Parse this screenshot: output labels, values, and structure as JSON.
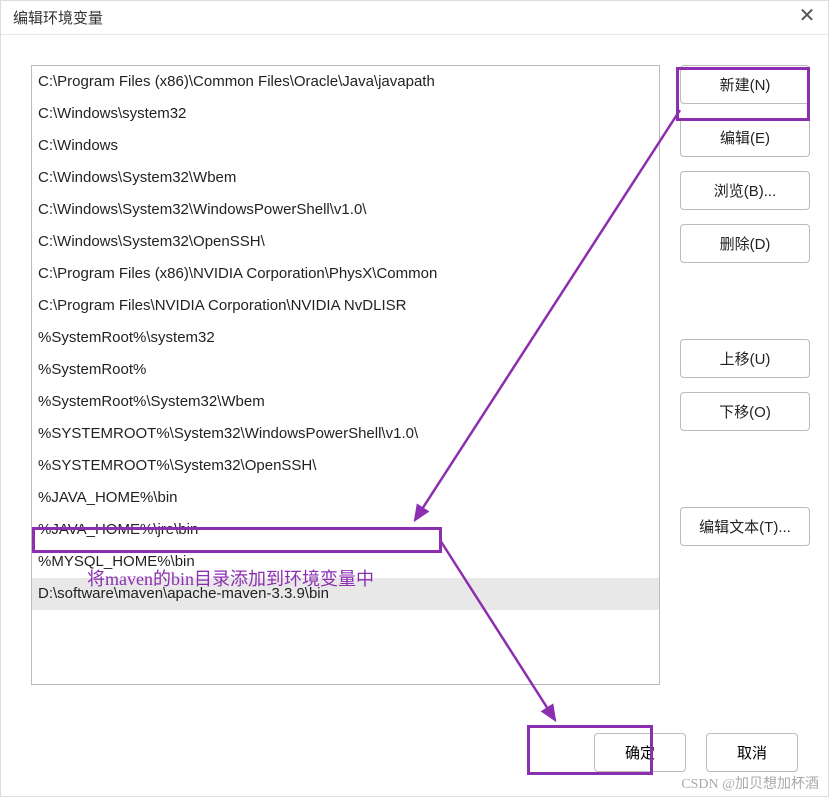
{
  "window": {
    "title": "编辑环境变量"
  },
  "list": {
    "items": [
      "C:\\Program Files (x86)\\Common Files\\Oracle\\Java\\javapath",
      "C:\\Windows\\system32",
      "C:\\Windows",
      "C:\\Windows\\System32\\Wbem",
      "C:\\Windows\\System32\\WindowsPowerShell\\v1.0\\",
      "C:\\Windows\\System32\\OpenSSH\\",
      "C:\\Program Files (x86)\\NVIDIA Corporation\\PhysX\\Common",
      "C:\\Program Files\\NVIDIA Corporation\\NVIDIA NvDLISR",
      "%SystemRoot%\\system32",
      "%SystemRoot%",
      "%SystemRoot%\\System32\\Wbem",
      "%SYSTEMROOT%\\System32\\WindowsPowerShell\\v1.0\\",
      "%SYSTEMROOT%\\System32\\OpenSSH\\",
      "%JAVA_HOME%\\bin",
      "%JAVA_HOME%\\jre\\bin",
      "%MYSQL_HOME%\\bin",
      "D:\\software\\maven\\apache-maven-3.3.9\\bin"
    ],
    "selected_index": 16
  },
  "buttons": {
    "new": "新建(N)",
    "edit": "编辑(E)",
    "browse": "浏览(B)...",
    "delete": "删除(D)",
    "move_up": "上移(U)",
    "move_down": "下移(O)",
    "edit_text": "编辑文本(T)...",
    "ok": "确定",
    "cancel": "取消"
  },
  "annotation": {
    "text": "将maven的bin目录添加到环境变量中",
    "highlight_color": "#8b2eb0"
  },
  "watermark": "CSDN @加贝想加杯酒"
}
